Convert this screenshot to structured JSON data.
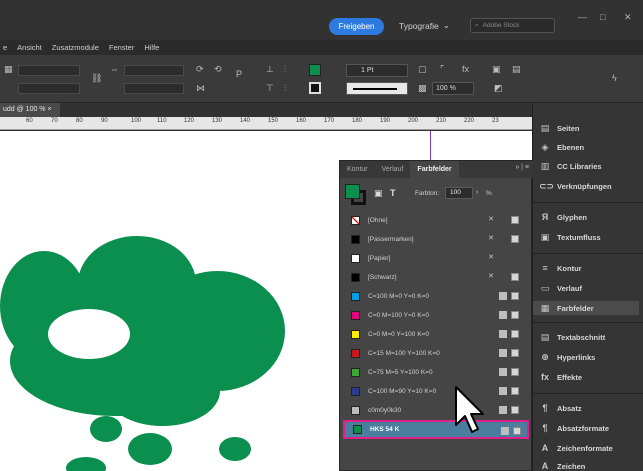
{
  "titlebar": {
    "share_label": "Freigeben",
    "workspace_label": "Typografie",
    "search_placeholder": "Adobe Stock"
  },
  "menu": [
    "e",
    "Ansicht",
    "Zusatzmodule",
    "Fenster",
    "Hilfe"
  ],
  "control": {
    "stroke_weight": "1 Pt",
    "opacity": "100 %"
  },
  "document_tab": "udd @ 100 % ×",
  "ruler": [
    "60",
    "70",
    "80",
    "90",
    "100",
    "110",
    "120",
    "130",
    "140",
    "150",
    "160",
    "170",
    "180",
    "190",
    "200",
    "210",
    "220",
    "23"
  ],
  "dock": {
    "items": [
      "Seiten",
      "Ebenen",
      "CC Libraries",
      "Verknüpfungen",
      "Glyphen",
      "Textumfluss",
      "Kontur",
      "Verlauf",
      "Farbfelder",
      "Textabschnitt",
      "Hyperlinks",
      "Effekte",
      "Absatz",
      "Absatzformate",
      "Zeichenformate",
      "Zeichen"
    ]
  },
  "swatches_panel": {
    "tabs": [
      "Kontur",
      "Verlauf",
      "Farbfelder"
    ],
    "tint_label": "Farbton:",
    "tint_value": "100",
    "tint_unit": "%",
    "colors": {
      "accent_green": "#0b8f4f",
      "selection_border": "#e01f8a",
      "selection_fill": "#4a7d9e"
    },
    "swatches": [
      {
        "name": "[Ohne]",
        "color": "none"
      },
      {
        "name": "[Passermarken]",
        "color": "#000000"
      },
      {
        "name": "[Papier]",
        "color": "#ffffff"
      },
      {
        "name": "[Schwarz]",
        "color": "#000000"
      },
      {
        "name": "C=100 M=0 Y=0 K=0",
        "color": "#009fe3"
      },
      {
        "name": "C=0 M=100 Y=0 K=0",
        "color": "#e5007d"
      },
      {
        "name": "C=0 M=0 Y=100 K=0",
        "color": "#ffed00"
      },
      {
        "name": "C=15 M=100 Y=100 K=0",
        "color": "#c8171e"
      },
      {
        "name": "C=75 M=5 Y=100 K=0",
        "color": "#3aaa35"
      },
      {
        "name": "C=100 M=90 Y=10 K=0",
        "color": "#2a3a8f"
      },
      {
        "name": "c0m0y0k30",
        "color": "#bdbdbd"
      },
      {
        "name": "HKS 54 K",
        "color": "#0b8f4f"
      }
    ]
  }
}
